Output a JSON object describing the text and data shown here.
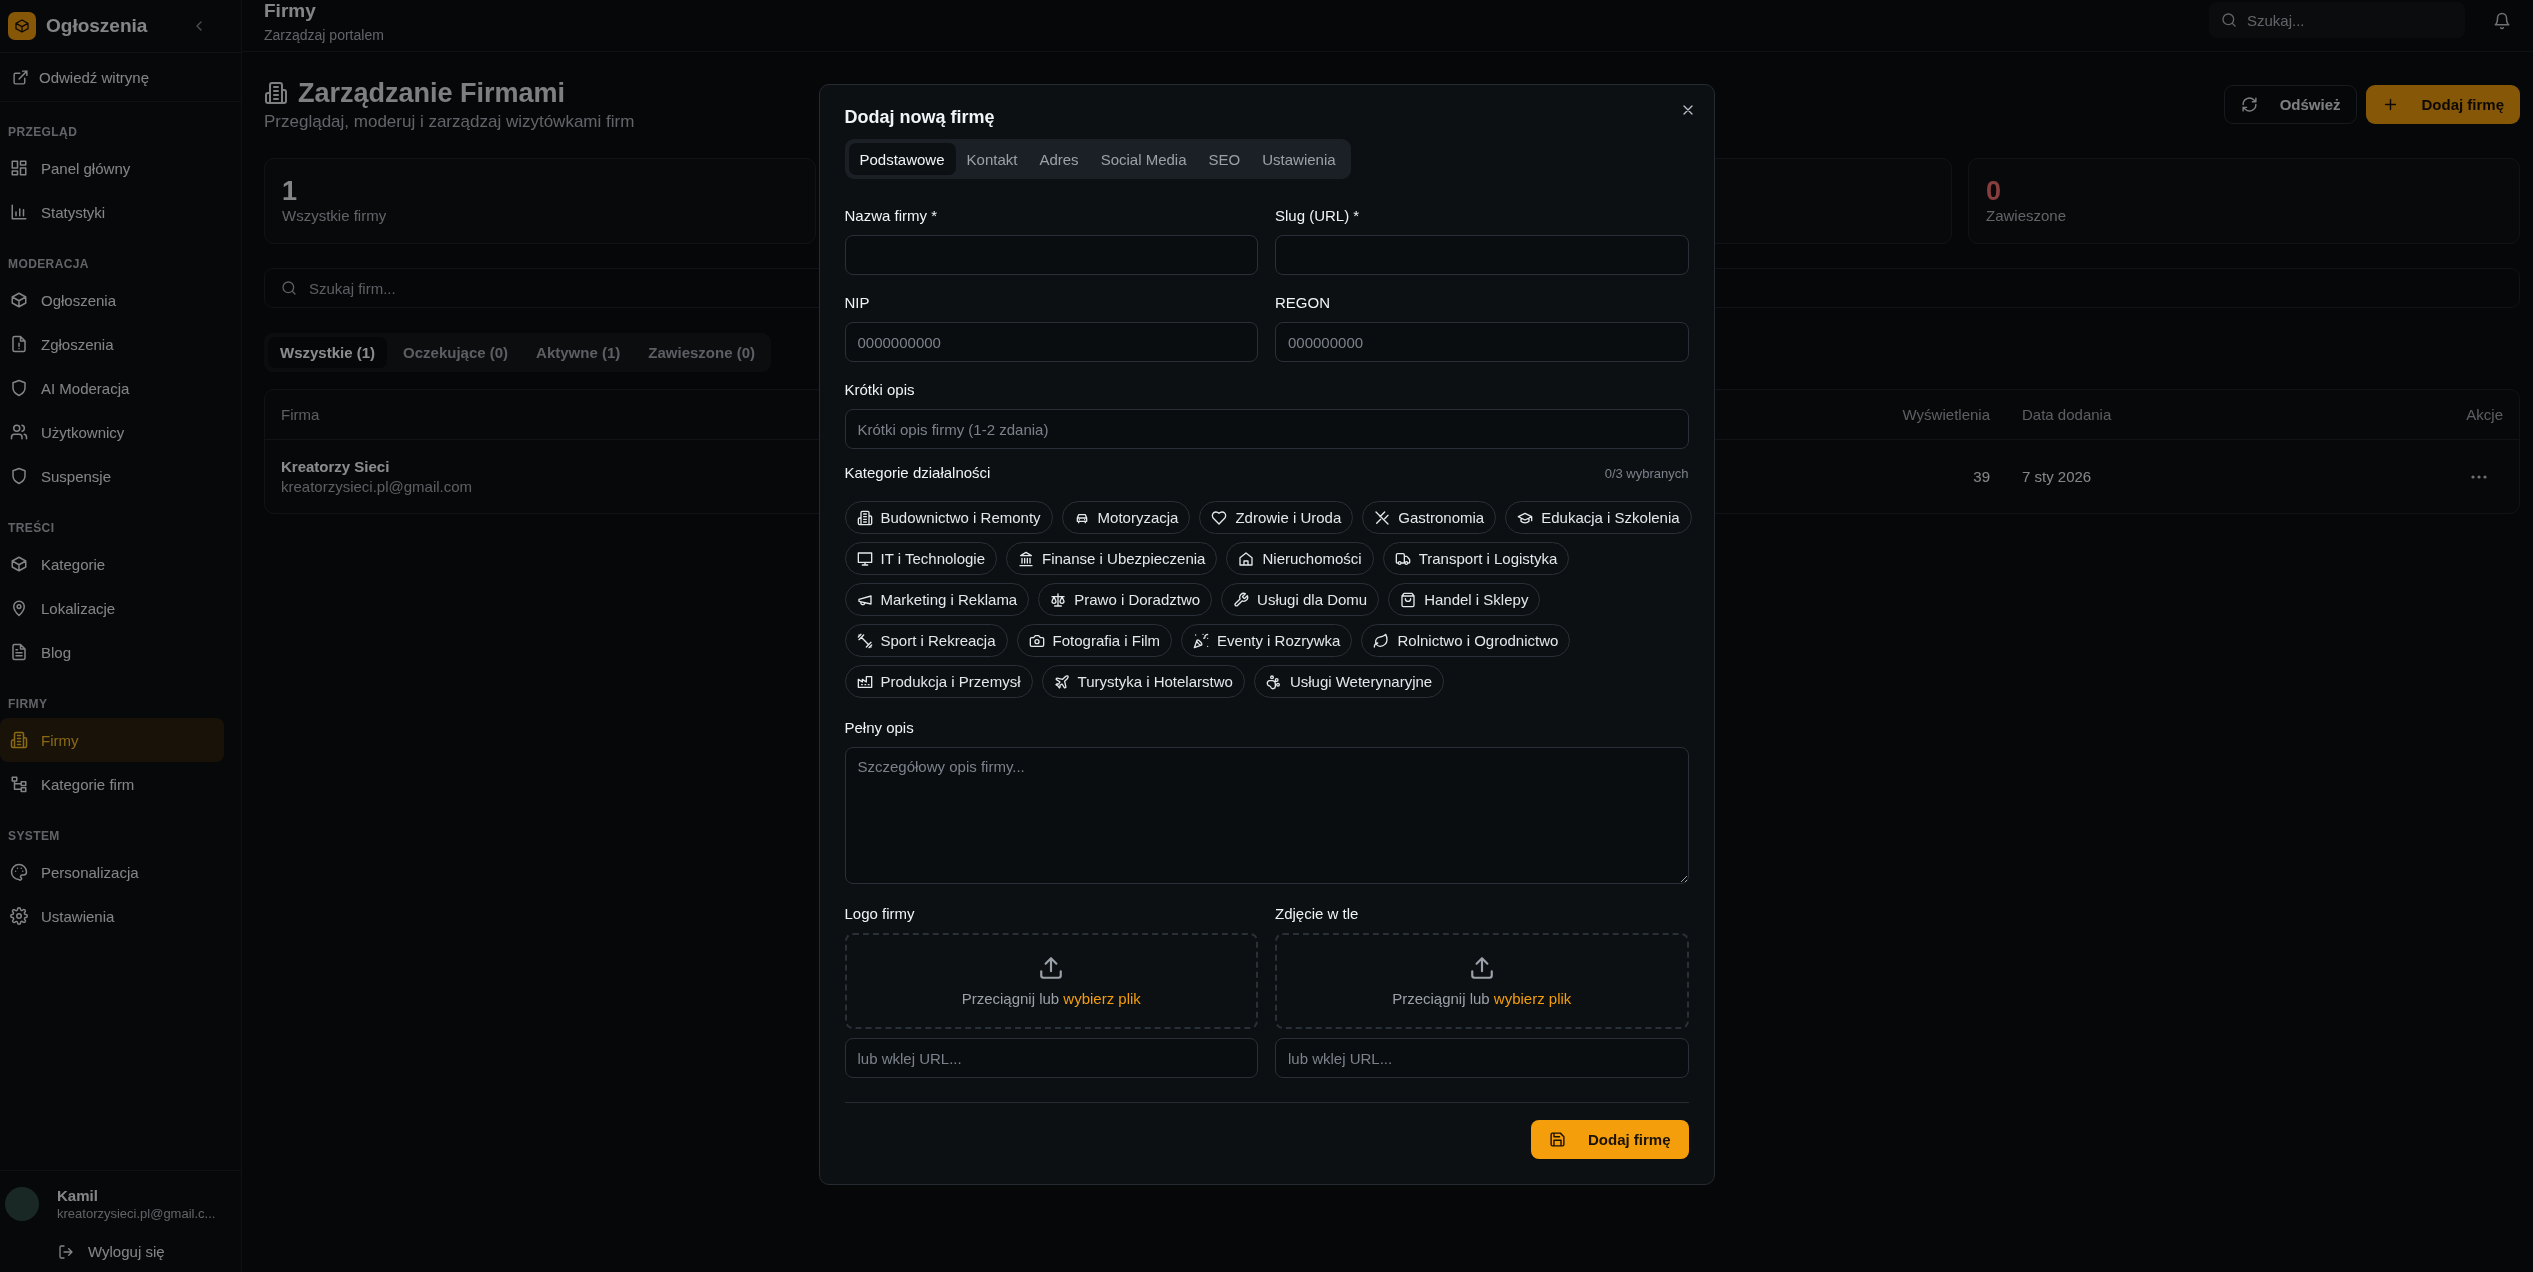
{
  "sidebar": {
    "brand": "Ogłoszenia",
    "visit_link": "Odwiedź witrynę",
    "sections": [
      {
        "title": "PRZEGLĄD",
        "items": [
          {
            "label": "Panel główny",
            "selected": false
          },
          {
            "label": "Statystyki",
            "selected": false
          }
        ]
      },
      {
        "title": "MODERACJA",
        "items": [
          {
            "label": "Ogłoszenia",
            "selected": false
          },
          {
            "label": "Zgłoszenia",
            "selected": false
          },
          {
            "label": "AI Moderacja",
            "selected": false
          },
          {
            "label": "Użytkownicy",
            "selected": false
          },
          {
            "label": "Suspensje",
            "selected": false
          }
        ]
      },
      {
        "title": "TREŚCI",
        "items": [
          {
            "label": "Kategorie",
            "selected": false
          },
          {
            "label": "Lokalizacje",
            "selected": false
          },
          {
            "label": "Blog",
            "selected": false
          }
        ]
      },
      {
        "title": "FIRMY",
        "items": [
          {
            "label": "Firmy",
            "selected": true
          },
          {
            "label": "Kategorie firm",
            "selected": false
          }
        ]
      },
      {
        "title": "SYSTEM",
        "items": [
          {
            "label": "Personalizacja",
            "selected": false
          },
          {
            "label": "Ustawienia",
            "selected": false
          }
        ]
      }
    ],
    "user": {
      "name": "Kamil",
      "email": "kreatorzysieci.pl@gmail.c..."
    },
    "logout": "Wyloguj się"
  },
  "topbar": {
    "title": "Firmy",
    "subtitle": "Zarządzaj portalem",
    "search": {
      "placeholder": "Szukaj..."
    }
  },
  "page": {
    "title": "Zarządzanie Firmami",
    "subtitle": "Przeglądaj, moderuj i zarządzaj wizytówkami firm",
    "buttons": [
      {
        "label": "Odśwież",
        "kind": "outline"
      },
      {
        "label": "Dodaj firmę",
        "kind": "primary"
      }
    ],
    "stats": [
      {
        "value": "1",
        "label": "Wszystkie firmy",
        "kind": "total"
      },
      {
        "value": "0",
        "label": "Zawieszone",
        "kind": "suspended"
      }
    ],
    "search": {
      "placeholder": "Szukaj firm..."
    },
    "filter_tabs": [
      {
        "label": "Wszystkie (1)",
        "selected": true
      },
      {
        "label": "Oczekujące (0)",
        "selected": false
      },
      {
        "label": "Aktywne (1)",
        "selected": false
      },
      {
        "label": "Zawieszone (0)",
        "selected": false
      }
    ],
    "table": {
      "columns": [
        "Firma",
        "Wyświetlenia",
        "Data dodania",
        "Akcje"
      ],
      "rows": [
        {
          "name": "Kreatorzy Sieci",
          "email": "kreatorzysieci.pl@gmail.com",
          "views": "39",
          "date": "7 sty 2026"
        }
      ]
    }
  },
  "modal": {
    "title": "Dodaj nową firmę",
    "tabs": [
      {
        "label": "Podstawowe",
        "selected": true
      },
      {
        "label": "Kontakt",
        "selected": false
      },
      {
        "label": "Adres",
        "selected": false
      },
      {
        "label": "Social Media",
        "selected": false
      },
      {
        "label": "SEO",
        "selected": false
      },
      {
        "label": "Ustawienia",
        "selected": false
      }
    ],
    "fields": [
      {
        "label": "Nazwa firmy *"
      },
      {
        "label": "Slug (URL) *"
      },
      {
        "label": "NIP",
        "placeholder": "0000000000"
      },
      {
        "label": "REGON",
        "placeholder": "000000000"
      }
    ],
    "short_description": {
      "label": "Krótki opis",
      "placeholder": "Krótki opis firmy (1-2 zdania)"
    },
    "categories": {
      "label": "Kategorie działalności",
      "counter": "0/3 wybranych",
      "rows": [
        {
          "items": [
            {
              "label": "Budownictwo i Remonty",
              "selected": false
            },
            {
              "label": "Motoryzacja",
              "selected": false
            },
            {
              "label": "Zdrowie i Uroda",
              "selected": false
            },
            {
              "label": "Gastronomia",
              "selected": false
            },
            {
              "label": "Edukacja i Szkolenia",
              "selected": false
            }
          ]
        },
        {
          "items": [
            {
              "label": "IT i Technologie",
              "selected": false
            },
            {
              "label": "Finanse i Ubezpieczenia",
              "selected": false
            },
            {
              "label": "Nieruchomości",
              "selected": false
            },
            {
              "label": "Transport i Logistyka",
              "selected": false
            }
          ]
        },
        {
          "items": [
            {
              "label": "Marketing i Reklama",
              "selected": false
            },
            {
              "label": "Prawo i Doradztwo",
              "selected": false
            },
            {
              "label": "Usługi dla Domu",
              "selected": false
            },
            {
              "label": "Handel i Sklepy",
              "selected": false
            }
          ]
        },
        {
          "items": [
            {
              "label": "Sport i Rekreacja",
              "selected": false
            },
            {
              "label": "Fotografia i Film",
              "selected": false
            },
            {
              "label": "Eventy i Rozrywka",
              "selected": false
            },
            {
              "label": "Rolnictwo i Ogrodnictwo",
              "selected": false
            }
          ]
        },
        {
          "items": [
            {
              "label": "Produkcja i Przemysł",
              "selected": false
            },
            {
              "label": "Turystyka i Hotelarstwo",
              "selected": false
            },
            {
              "label": "Usługi Weterynaryjne",
              "selected": false
            }
          ]
        }
      ]
    },
    "full_description": {
      "label": "Pełny opis",
      "placeholder": "Szczegółowy opis firmy..."
    },
    "uploads": [
      {
        "label": "Logo firmy",
        "text": "Przeciągnij lub",
        "link": "wybierz plik",
        "url_placeholder": "lub wklej URL..."
      },
      {
        "label": "Zdjęcie w tle",
        "text": "Przeciągnij lub",
        "link": "wybierz plik",
        "url_placeholder": "lub wklej URL..."
      }
    ],
    "submit": "Dodaj firmę"
  }
}
